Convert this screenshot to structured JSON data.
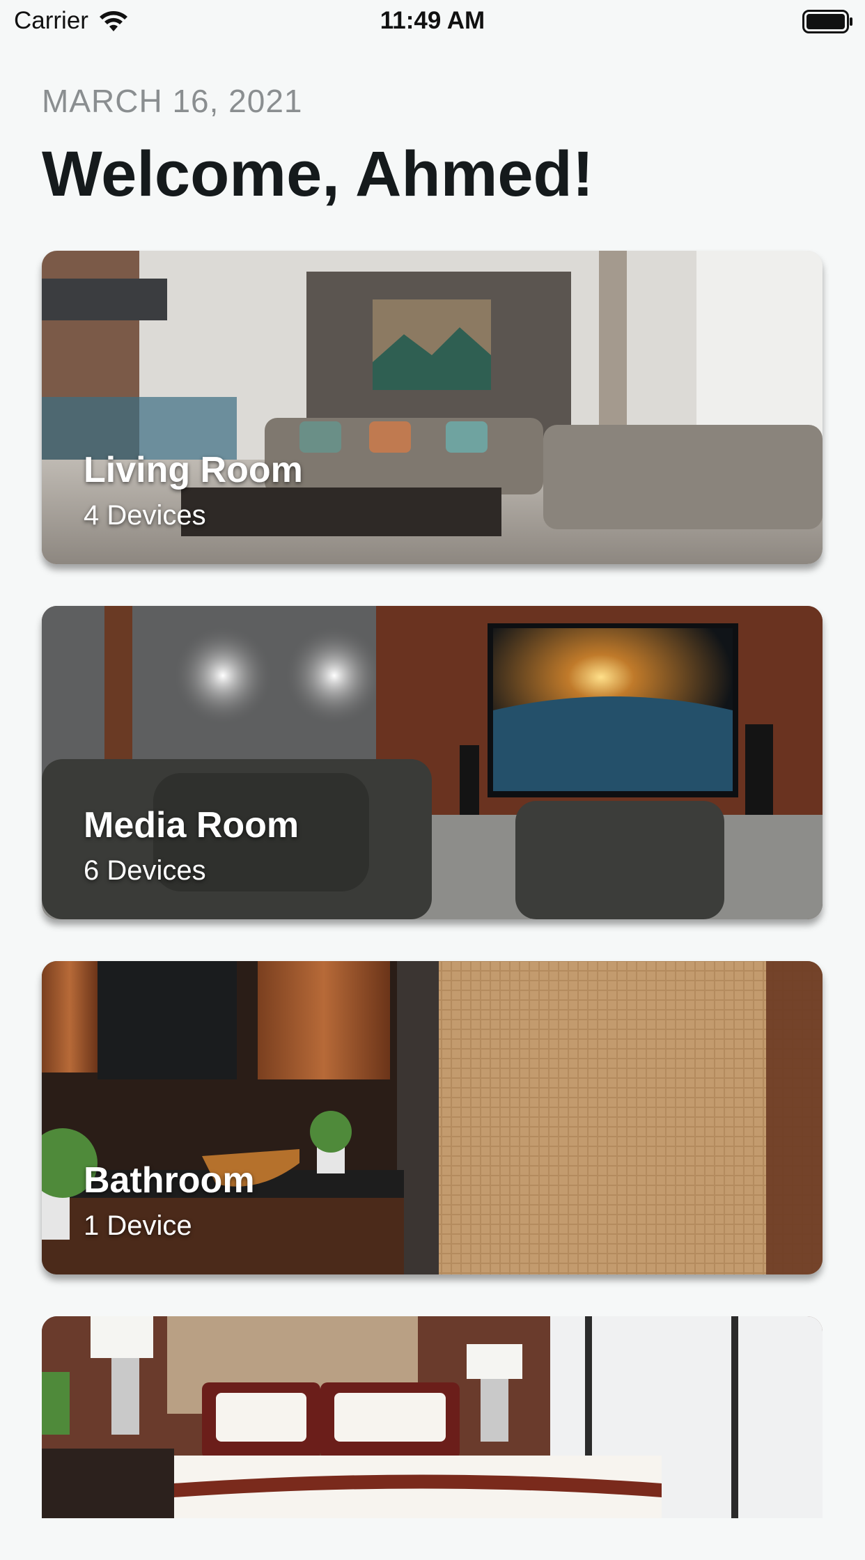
{
  "status_bar": {
    "carrier": "Carrier",
    "time": "11:49 AM"
  },
  "header": {
    "date": "MARCH 16, 2021",
    "welcome": "Welcome, Ahmed!"
  },
  "rooms": [
    {
      "name": "Living Room",
      "devices": "4 Devices"
    },
    {
      "name": "Media Room",
      "devices": "6 Devices"
    },
    {
      "name": "Bathroom",
      "devices": "1 Device"
    },
    {
      "name": "",
      "devices": ""
    }
  ]
}
